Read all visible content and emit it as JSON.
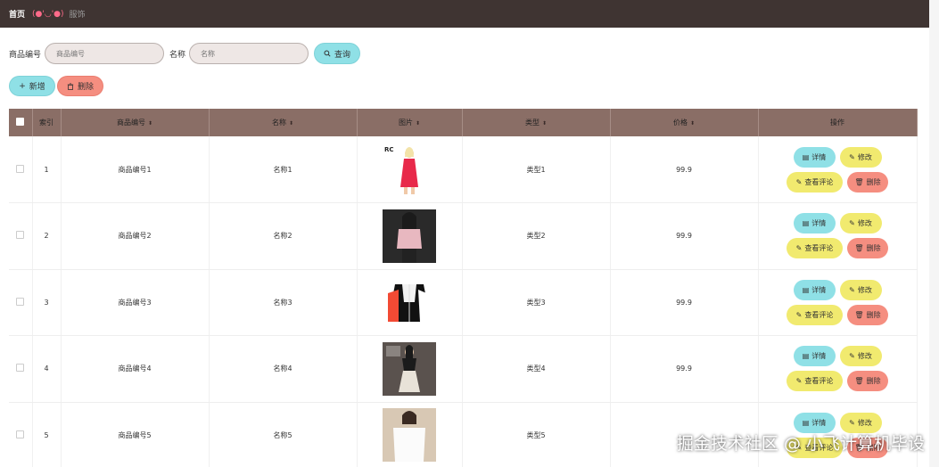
{
  "breadcrumb": {
    "home": "首页",
    "face": "(●'◡'●)",
    "current": "服饰"
  },
  "search": {
    "code_label": "商品编号",
    "code_placeholder": "商品编号",
    "name_label": "名称",
    "name_placeholder": "名称",
    "query_label": "查询"
  },
  "actions": {
    "add_label": "新增",
    "delete_label": "删除"
  },
  "table": {
    "headers": {
      "index": "索引",
      "code": "商品编号",
      "name": "名称",
      "image": "图片",
      "type": "类型",
      "price": "价格",
      "ops": "操作"
    },
    "rows": [
      {
        "index": "1",
        "code": "商品编号1",
        "name": "名称1",
        "type": "类型1",
        "price": "99.9",
        "image_icon": "red-dress-photo",
        "image_text": "RC"
      },
      {
        "index": "2",
        "code": "商品编号2",
        "name": "名称2",
        "type": "类型2",
        "price": "99.9",
        "image_icon": "pink-sweater-photo"
      },
      {
        "index": "3",
        "code": "商品编号3",
        "name": "名称3",
        "type": "类型3",
        "price": "99.9",
        "image_icon": "black-jacket-photo"
      },
      {
        "index": "4",
        "code": "商品编号4",
        "name": "名称4",
        "type": "类型4",
        "price": "99.9",
        "image_icon": "dark-dress-photo"
      },
      {
        "index": "5",
        "code": "商品编号5",
        "name": "名称5",
        "type": "类型5",
        "price": "",
        "image_icon": "white-shirt-photo"
      }
    ],
    "op_labels": {
      "detail": "详情",
      "edit": "修改",
      "comment": "查看评论",
      "delete": "删除"
    }
  },
  "watermark": "掘金技术社区 @ 小飞计算机毕设",
  "colors": {
    "topbar": "#3f3432",
    "header": "#8a6e66",
    "cyan": "#8fe0e6",
    "yellow": "#f1ea6f",
    "salmon": "#f58e80"
  }
}
